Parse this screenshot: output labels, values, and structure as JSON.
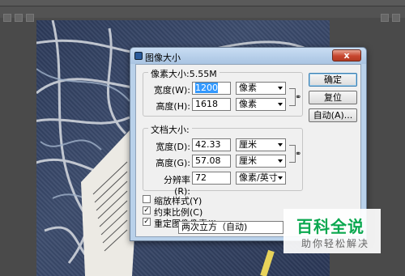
{
  "dialog": {
    "title": "图像大小",
    "close_label": "x",
    "pixel_dimensions": {
      "title": "像素大小:5.55M",
      "width_label": "宽度(W):",
      "width_value": "1200",
      "width_unit": "像素",
      "height_label": "高度(H):",
      "height_value": "1618",
      "height_unit": "像素"
    },
    "document_size": {
      "title": "文档大小:",
      "width_label": "宽度(D):",
      "width_value": "42.33",
      "width_unit": "厘米",
      "height_label": "高度(G):",
      "height_value": "57.08",
      "height_unit": "厘米",
      "resolution_label": "分辨率(R):",
      "resolution_value": "72",
      "resolution_unit": "像素/英寸"
    },
    "buttons": {
      "ok": "确定",
      "reset": "复位",
      "auto": "自动(A)..."
    },
    "options": {
      "scale_styles": "缩放样式(Y)",
      "scale_styles_checked": false,
      "constrain": "约束比例(C)",
      "constrain_checked": true,
      "resample": "重定图像像素(I):",
      "resample_checked": true,
      "resample_method": "两次立方（自动)"
    }
  },
  "watermark": {
    "main": "百科全说",
    "sub": "助你轻松解决"
  },
  "icons": {
    "link": "link-chain-icon",
    "dropdown": "chevron-down-icon"
  }
}
